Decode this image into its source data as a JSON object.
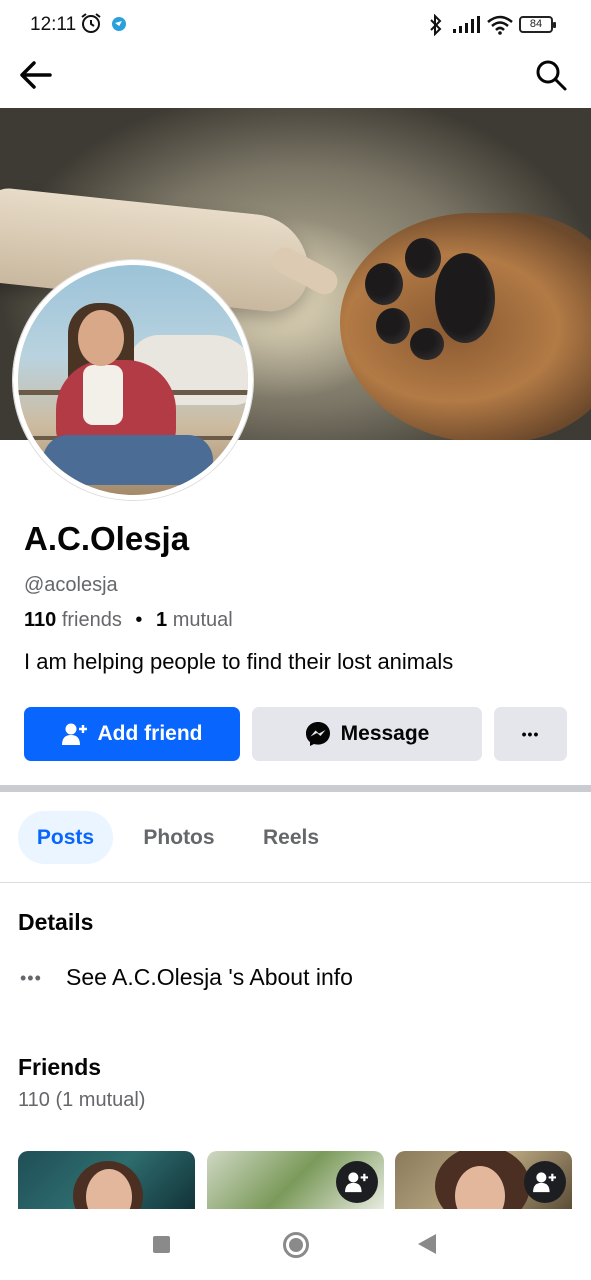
{
  "status_bar": {
    "time": "12:11",
    "battery": "84"
  },
  "profile": {
    "name": "A.C.Olesja",
    "username": "@acolesja",
    "friends_count": "110",
    "friends_word": "friends",
    "separator": "•",
    "mutual_count": "1",
    "mutual_word": "mutual",
    "bio": "I am helping people to find their lost animals"
  },
  "actions": {
    "add_friend": "Add friend",
    "message": "Message",
    "more": "•••"
  },
  "tabs": [
    {
      "label": "Posts",
      "active": true
    },
    {
      "label": "Photos",
      "active": false
    },
    {
      "label": "Reels",
      "active": false
    }
  ],
  "details": {
    "title": "Details",
    "about_dots": "•••",
    "about_text": "See A.C.Olesja 's About info"
  },
  "friends": {
    "title": "Friends",
    "count_text": "110 (1 mutual)"
  },
  "colors": {
    "primary": "#0866ff",
    "secondary_button": "#e4e6eb",
    "tab_active_bg": "#ebf5ff",
    "muted_text": "#65676b"
  },
  "icons": [
    "alarm-icon",
    "telegram-icon",
    "bluetooth-icon",
    "signal-icon",
    "wifi-icon",
    "back-arrow-icon",
    "search-icon",
    "add-friend-icon",
    "messenger-icon",
    "more-dots-icon"
  ]
}
